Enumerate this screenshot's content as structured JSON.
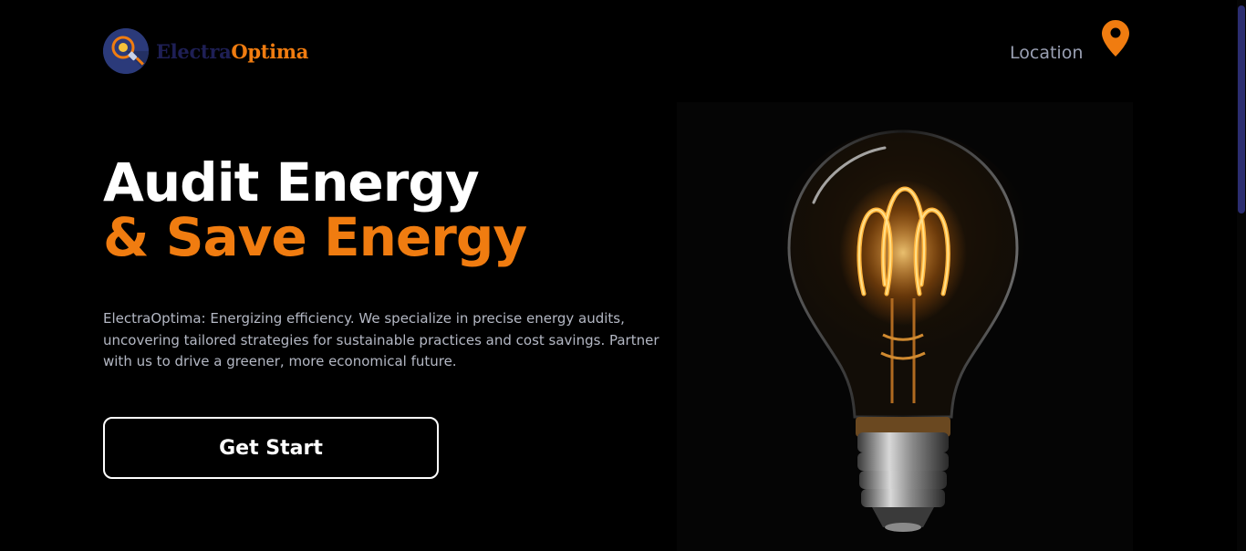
{
  "brand": {
    "name_part1": "Electra",
    "name_part2": "Optima",
    "logo_icon": "bulb-plug-logo-icon",
    "colors": {
      "accent": "#f07c10",
      "dark": "#1e1f55",
      "logo_bg": "#2b3a7a"
    }
  },
  "header": {
    "location_label": "Location",
    "location_icon": "map-pin-icon"
  },
  "hero": {
    "headline_line1": "Audit Energy",
    "headline_line2": "& Save Energy",
    "description": "ElectraOptima: Energizing efficiency. We specialize in precise energy audits, uncovering tailored strategies for sustainable practices and cost savings. Partner with us to drive a greener, more economical future.",
    "cta_label": "Get Start",
    "image_subject": "glowing-light-bulb"
  }
}
